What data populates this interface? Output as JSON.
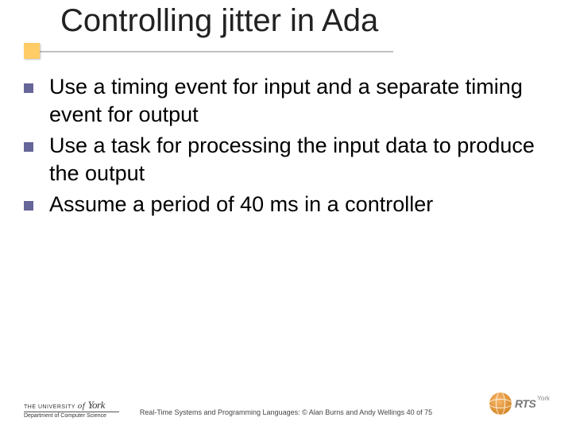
{
  "title": "Controlling jitter in Ada",
  "bullets": [
    "Use a timing event for input and a separate timing event for output",
    "Use a task for processing the input data to produce the output",
    "Assume a period of 40 ms in a controller"
  ],
  "footer": {
    "center": "Real-Time Systems and Programming Languages: © Alan Burns and Andy Wellings 40 of 75",
    "uy_line1_pre": "THE UNIVERSITY",
    "uy_line1_of": "of",
    "uy_line1_york": "York",
    "uy_dept": "Department of Computer Science",
    "rts": "RTS",
    "rts_york": "York"
  }
}
